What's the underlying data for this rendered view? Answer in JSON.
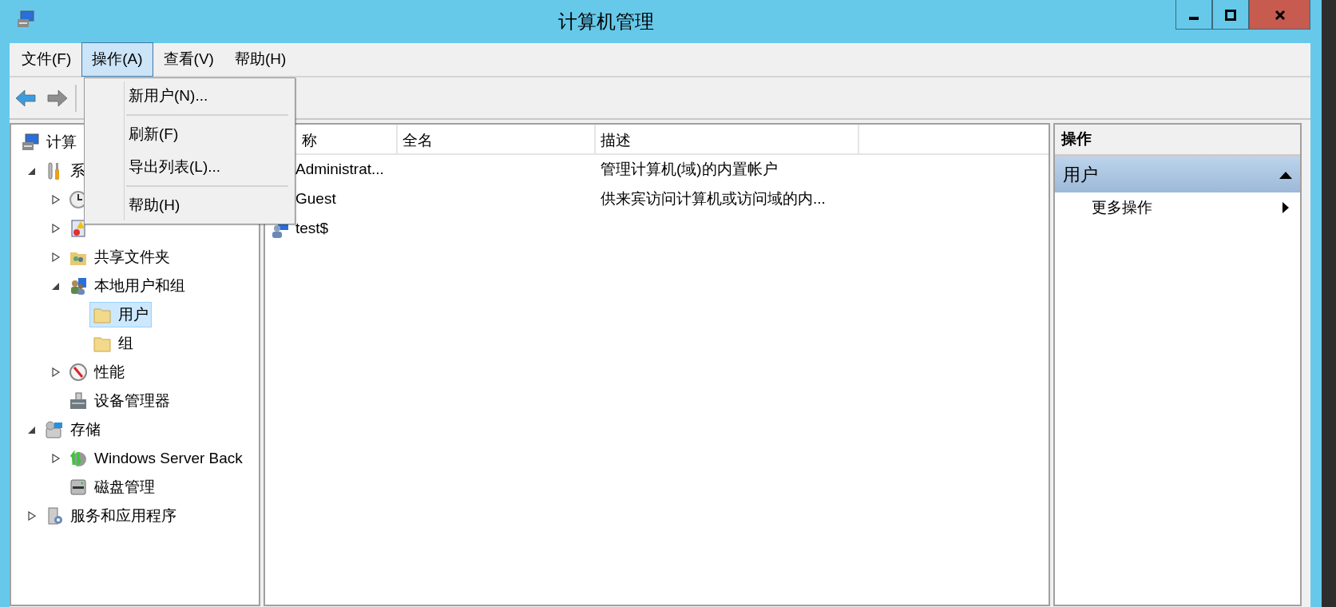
{
  "window": {
    "title": "计算机管理"
  },
  "menubar": [
    {
      "label": "文件(F)",
      "selected": false
    },
    {
      "label": "操作(A)",
      "selected": true
    },
    {
      "label": "查看(V)",
      "selected": false
    },
    {
      "label": "帮助(H)",
      "selected": false
    }
  ],
  "toolbar": [
    {
      "kind": "back",
      "disabled": false
    },
    {
      "kind": "forward",
      "disabled": true
    }
  ],
  "dropdown_menu": [
    {
      "kind": "item",
      "label": "新用户(N)..."
    },
    {
      "kind": "separator"
    },
    {
      "kind": "item",
      "label": "刷新(F)"
    },
    {
      "kind": "item",
      "label": "导出列表(L)..."
    },
    {
      "kind": "separator"
    },
    {
      "kind": "item",
      "label": "帮助(H)"
    }
  ],
  "tree": [
    {
      "kind": "computer",
      "label": "计算",
      "selected": false,
      "children": [
        {
          "kind": "tools",
          "label": "系",
          "expanded": true,
          "selected": false,
          "children": [
            {
              "kind": "clock",
              "expanded": false,
              "selected": false
            },
            {
              "kind": "event",
              "expanded": false,
              "selected": false
            },
            {
              "kind": "share",
              "label": "共享文件夹",
              "expanded": false,
              "selected": false
            },
            {
              "kind": "users",
              "label": "本地用户和组",
              "expanded": true,
              "selected": false,
              "children": [
                {
                  "kind": "folder",
                  "label": "用户",
                  "selected": true
                },
                {
                  "kind": "folder",
                  "label": "组",
                  "selected": false
                }
              ]
            },
            {
              "kind": "perf",
              "label": "性能",
              "expanded": false,
              "selected": false
            },
            {
              "kind": "device",
              "label": "设备管理器",
              "selected": false
            }
          ]
        },
        {
          "kind": "storage",
          "label": "存储",
          "expanded": true,
          "selected": false,
          "children": [
            {
              "kind": "backup",
              "label": "Windows Server Back",
              "expanded": false,
              "selected": false
            },
            {
              "kind": "disk",
              "label": "磁盘管理",
              "selected": false
            }
          ]
        },
        {
          "kind": "services",
          "label": "服务和应用程序",
          "expanded": false,
          "selected": false
        }
      ]
    }
  ],
  "list": {
    "columns": [
      "称",
      "全名",
      "描述"
    ],
    "rows": [
      {
        "name": "Administrat...",
        "description": "管理计算机(域)的内置帐户"
      },
      {
        "name": "Guest",
        "description": "供来宾访问计算机或访问域的内..."
      },
      {
        "name": "test$",
        "icon": true
      }
    ]
  },
  "actions": {
    "header": "操作",
    "sections": [
      {
        "label": "用户",
        "expanded": true,
        "items": [
          "更多操作"
        ]
      }
    ]
  }
}
